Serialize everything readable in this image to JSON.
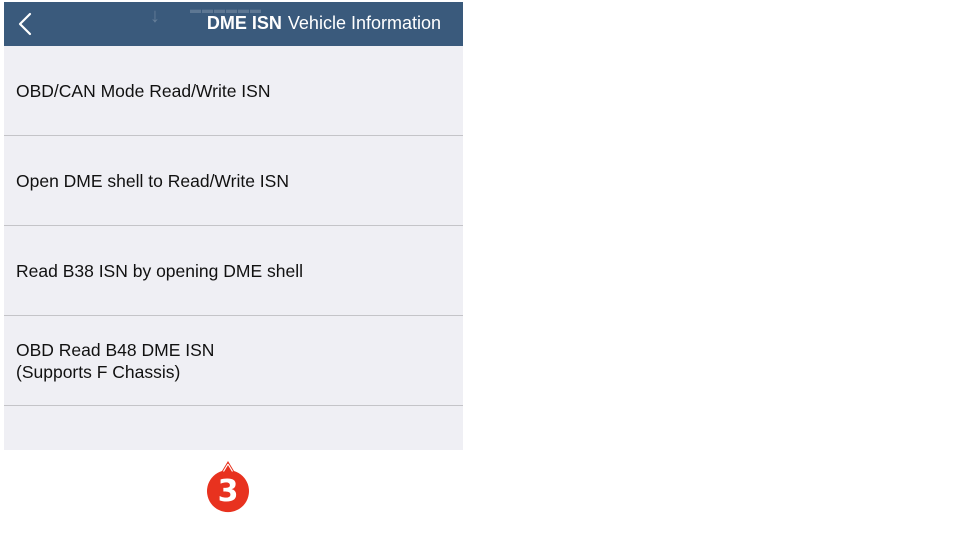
{
  "navbar": {
    "back_icon": "chevron-left-icon",
    "title_strong": "DME ISN",
    "title_sub": "Vehicle Information",
    "background": "#3a5a7c"
  },
  "menu": {
    "items": [
      {
        "label": "OBD/CAN Mode Read/Write ISN"
      },
      {
        "label": "Open DME shell to Read/Write ISN"
      },
      {
        "label": "Read B38 ISN by opening DME shell"
      },
      {
        "label": "OBD Read B48 DME ISN\n(Supports F Chassis)"
      }
    ]
  },
  "step_badge": {
    "number": "3",
    "color": "#e8321f"
  }
}
